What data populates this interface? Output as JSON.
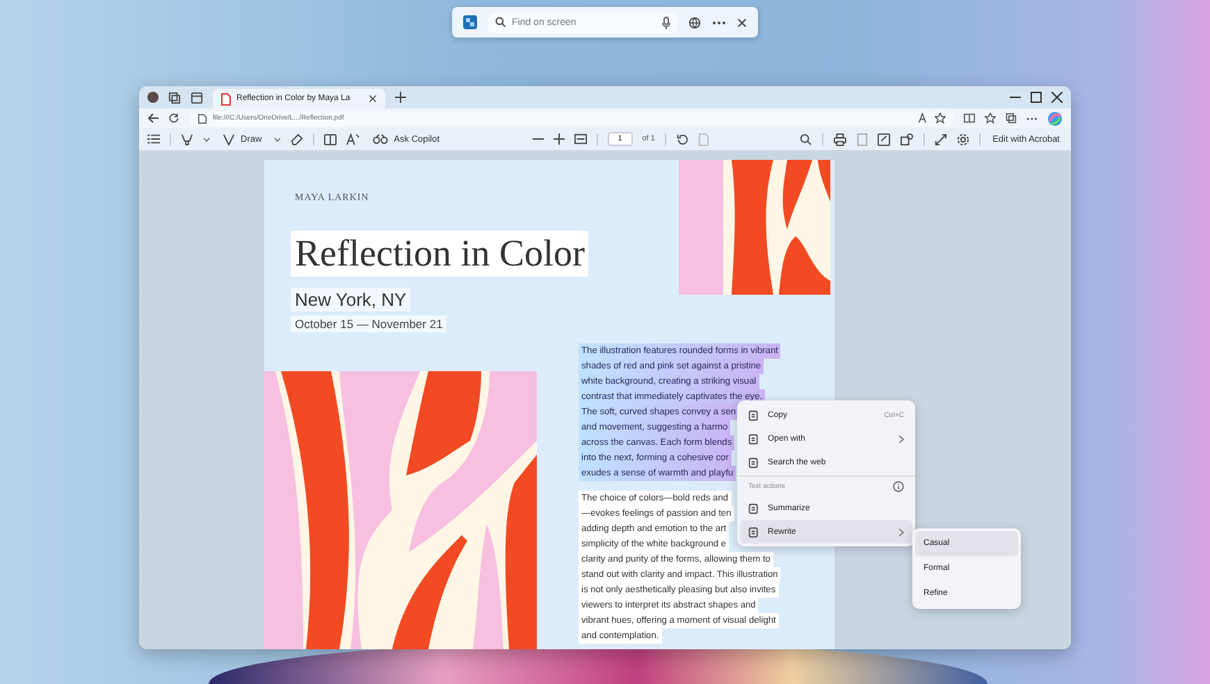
{
  "find_bar": {
    "placeholder": "Find on screen"
  },
  "browser": {
    "tab_title": "Reflection in Color by Maya La",
    "address": "file:///C:/Users/OneDrive/L.../Reflection.pdf"
  },
  "pdf_toolbar": {
    "draw_label": "Draw",
    "ask_copilot": "Ask Copilot",
    "page_number": "1",
    "page_count": "of 1",
    "edit_button": "Edit with Acrobat"
  },
  "document": {
    "author": "MAYA LARKIN",
    "title": "Reflection in Color",
    "city": "New York, NY",
    "dates": "October 15 — November 21",
    "selected_lines": [
      "The illustration features rounded forms in vibrant",
      "shades of red and pink set against a pristine",
      "white background, creating a striking visual",
      "contrast that immediately captivates the eye.",
      "The soft, curved shapes convey a sen",
      "and movement, suggesting a harmo",
      "across the canvas. Each form blends",
      "into the next, forming a cohesive cor",
      "exudes a sense of warmth and playfu"
    ],
    "lines": [
      "The choice of colors—bold reds and",
      "—evokes feelings of passion and ten",
      "adding depth and emotion to the art",
      "simplicity of the white background e",
      "clarity and purity of the forms, allowing them to",
      "stand out with clarity and impact. This illustration",
      "is not only aesthetically pleasing but also invites",
      "viewers to interpret its abstract shapes and",
      "vibrant hues, offering a moment of visual delight",
      "and contemplation."
    ]
  },
  "context_menu": {
    "items": [
      {
        "kind": "item",
        "label": "Copy",
        "shortcut": "Ctrl+C",
        "selected": false
      },
      {
        "kind": "submenu",
        "label": "Open with",
        "selected": false
      },
      {
        "kind": "item",
        "label": "Search the web",
        "selected": false
      },
      {
        "kind": "header",
        "label": "Text actions"
      },
      {
        "kind": "item",
        "label": "Summarize",
        "selected": false
      },
      {
        "kind": "submenu",
        "label": "Rewrite",
        "selected": true
      }
    ]
  },
  "submenu": {
    "items": [
      {
        "label": "Casual",
        "selected": true
      },
      {
        "label": "Formal",
        "selected": false
      },
      {
        "label": "Refine",
        "selected": false
      }
    ]
  }
}
